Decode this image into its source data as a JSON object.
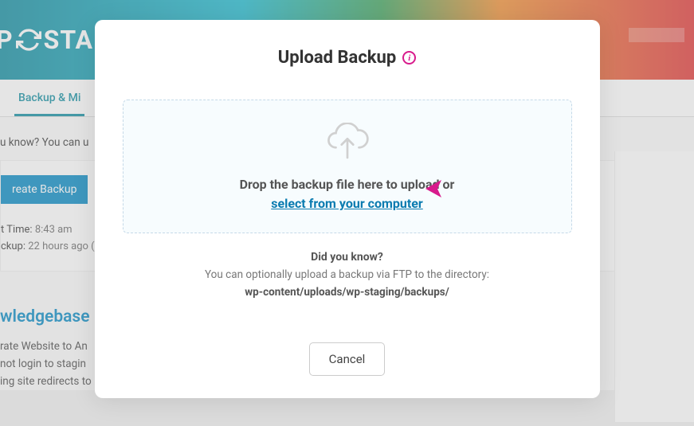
{
  "banner": {
    "logo_text_left": "P",
    "logo_text_right": "STA"
  },
  "tabs": {
    "backup_label": "Backup & Mi"
  },
  "background": {
    "did_you_know": "u know? You can u",
    "create_backup_btn": "reate Backup",
    "time_label": "t Time:",
    "time_value": " 8:43 am",
    "backup_label": "ckup:",
    "backup_value": " 22 hours ago (",
    "kb_title": "wledgebase",
    "kb_link1": "rate Website to An",
    "kb_link2": "not login to stagin",
    "kb_link3": "ing site redirects to production site"
  },
  "modal": {
    "title": "Upload Backup",
    "dropzone_text": "Drop the backup file here to upload or",
    "dropzone_link": "select from your computer",
    "dyk_title": "Did you know?",
    "dyk_text": "You can optionally upload a backup via FTP to the directory:",
    "dyk_path": "wp-content/uploads/wp-staging/backups/",
    "cancel_btn": "Cancel"
  }
}
